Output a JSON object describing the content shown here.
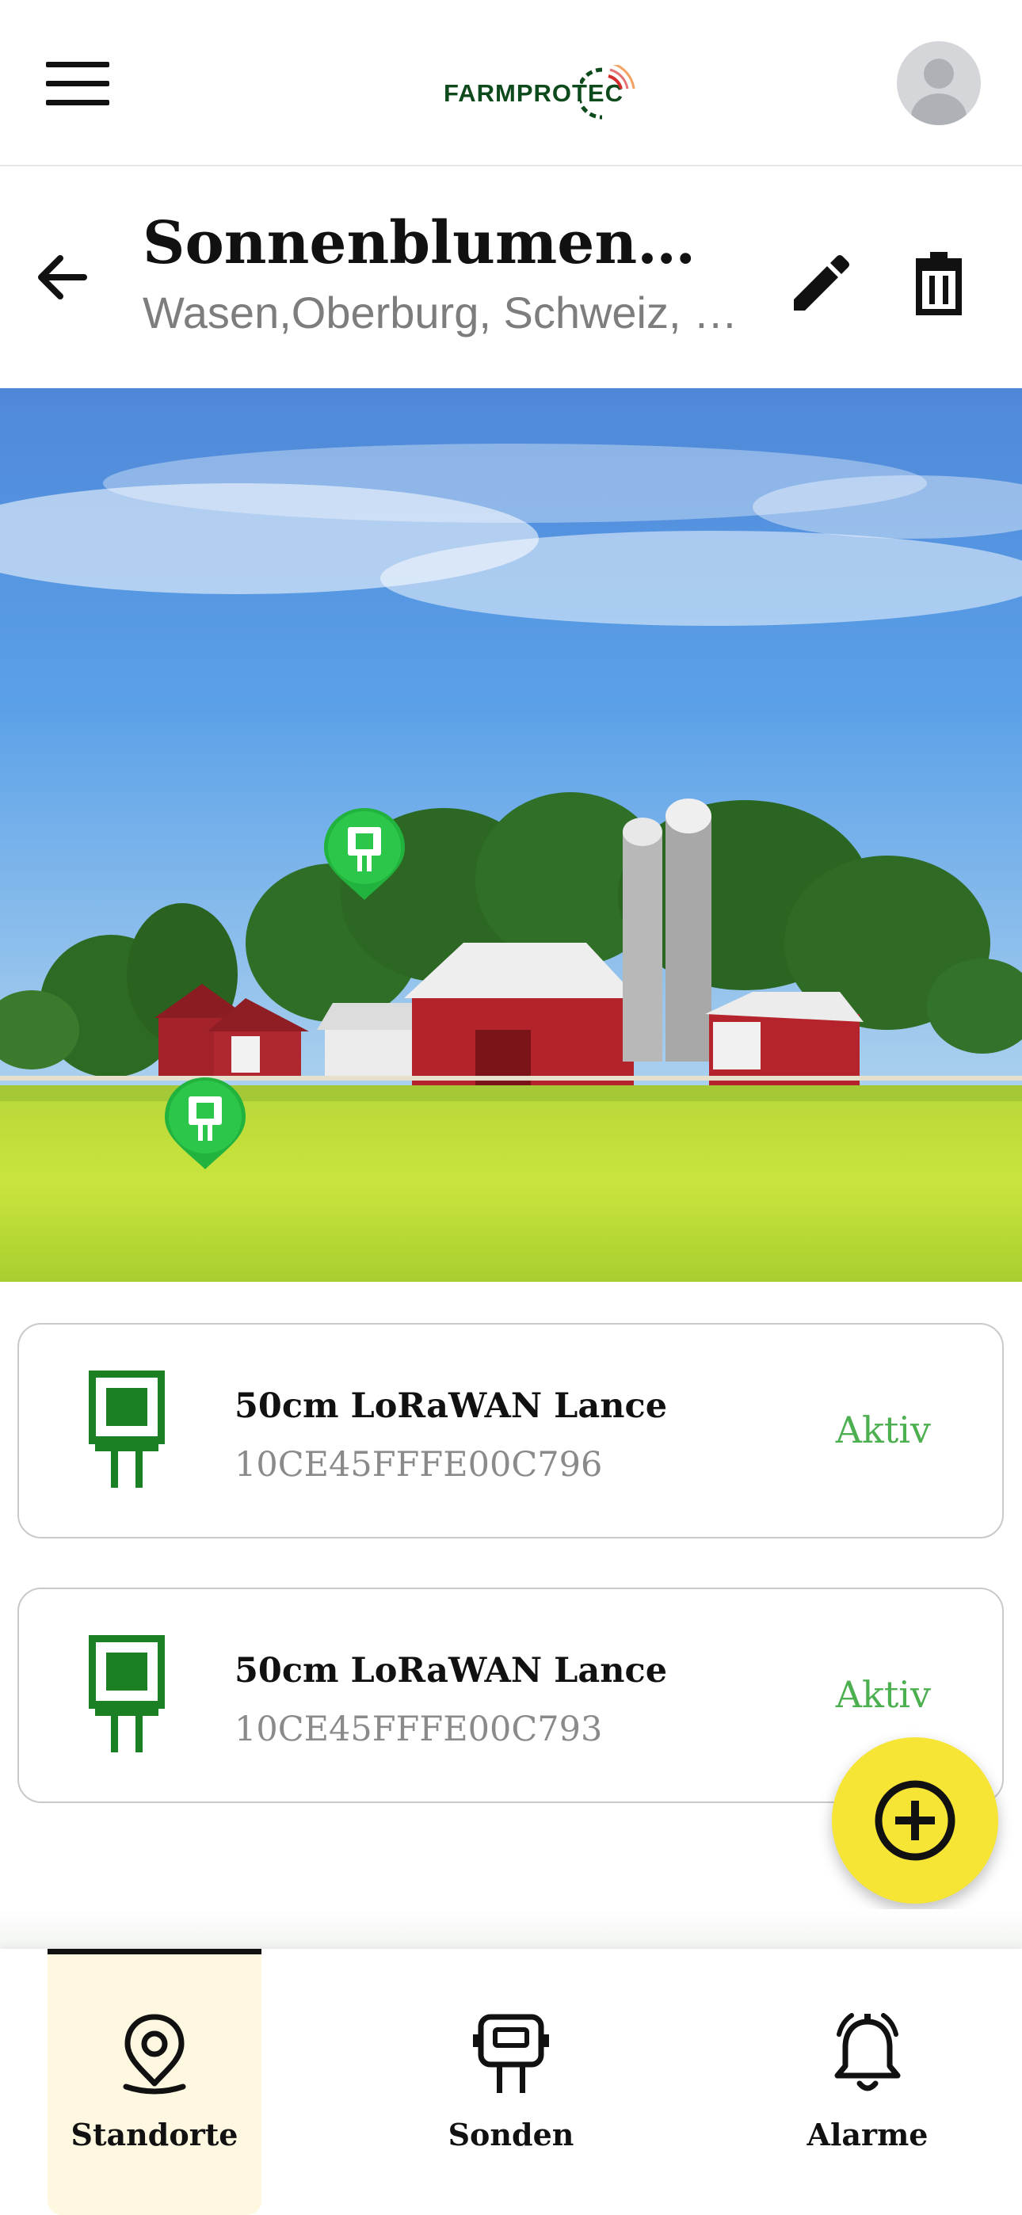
{
  "header": {
    "logo_text": "FARMPROTEC",
    "menu_icon": "hamburger-menu-icon",
    "avatar_icon": "user-avatar-icon"
  },
  "location": {
    "title": "Sonnenblumenhof …",
    "subtitle": "Wasen,Oberburg, Schweiz, 3…",
    "icons": [
      "arrow-back-icon",
      "pencil-edit-icon",
      "trash-icon"
    ]
  },
  "scene": {
    "pins": [
      {
        "name": "sensor-pin-1",
        "icon": "sensor-pin-icon"
      },
      {
        "name": "sensor-pin-2",
        "icon": "sensor-pin-icon"
      }
    ]
  },
  "sensors": [
    {
      "name": "50cm LoRaWAN Lance",
      "id": "10CE45FFFE00C796",
      "status": "Aktiv"
    },
    {
      "name": "50cm LoRaWAN Lance",
      "id": "10CE45FFFE00C793",
      "status": "Aktiv"
    }
  ],
  "fab": {
    "icon": "add-circle-icon"
  },
  "nav": {
    "items": [
      {
        "label": "Standorte",
        "icon": "location-pin-icon",
        "active": true
      },
      {
        "label": "Sonden",
        "icon": "sensor-probe-icon",
        "active": false
      },
      {
        "label": "Alarme",
        "icon": "alarm-bell-icon",
        "active": false
      }
    ]
  },
  "colors": {
    "brand_dark_green": "#0d4a1c",
    "sensor_green": "#1b7f24",
    "status_green": "#4caf50",
    "fab_yellow": "#f6e535",
    "nav_active_bg": "#fdf8df"
  }
}
